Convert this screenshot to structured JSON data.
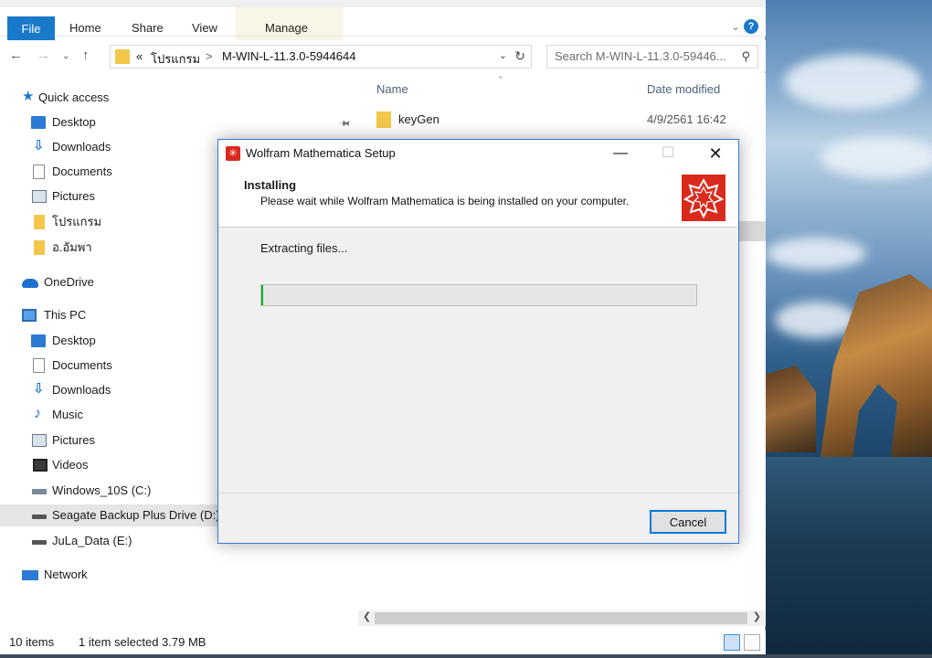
{
  "explorer": {
    "ribbon_tabs": [
      "File",
      "Home",
      "Share",
      "View",
      "Manage"
    ],
    "help_label": "?",
    "breadcrumb": {
      "overflow": "«",
      "parts": [
        "โปรแกรม",
        "M-WIN-L-11.3.0-5944644"
      ],
      "separator": ">"
    },
    "search_placeholder": "Search M-WIN-L-11.3.0-59446...",
    "nav": {
      "quick_access": "Quick access",
      "quick_items": [
        "Desktop",
        "Downloads",
        "Documents",
        "Pictures",
        "โปรแกรม",
        "อ.อัมพา"
      ],
      "onedrive": "OneDrive",
      "this_pc": "This PC",
      "pc_items": [
        "Desktop",
        "Documents",
        "Downloads",
        "Music",
        "Pictures",
        "Videos",
        "Windows_10S (C:)",
        "Seagate Backup Plus Drive (D:)",
        "JuLa_Data (E:)"
      ],
      "network": "Network"
    },
    "columns": {
      "name": "Name",
      "date": "Date modified"
    },
    "files": [
      {
        "name": "keyGen",
        "date": "4/9/2561 16:42"
      }
    ],
    "status": {
      "item_count": "10 items",
      "selection": "1 item selected  3.79 MB"
    }
  },
  "dialog": {
    "title": "Wolfram Mathematica Setup",
    "header_title": "Installing",
    "header_subtitle": "Please wait while Wolfram Mathematica is being installed on your computer.",
    "status_text": "Extracting files...",
    "progress": 0.003,
    "cancel_label": "Cancel",
    "accent_color": "#da2a1d"
  }
}
